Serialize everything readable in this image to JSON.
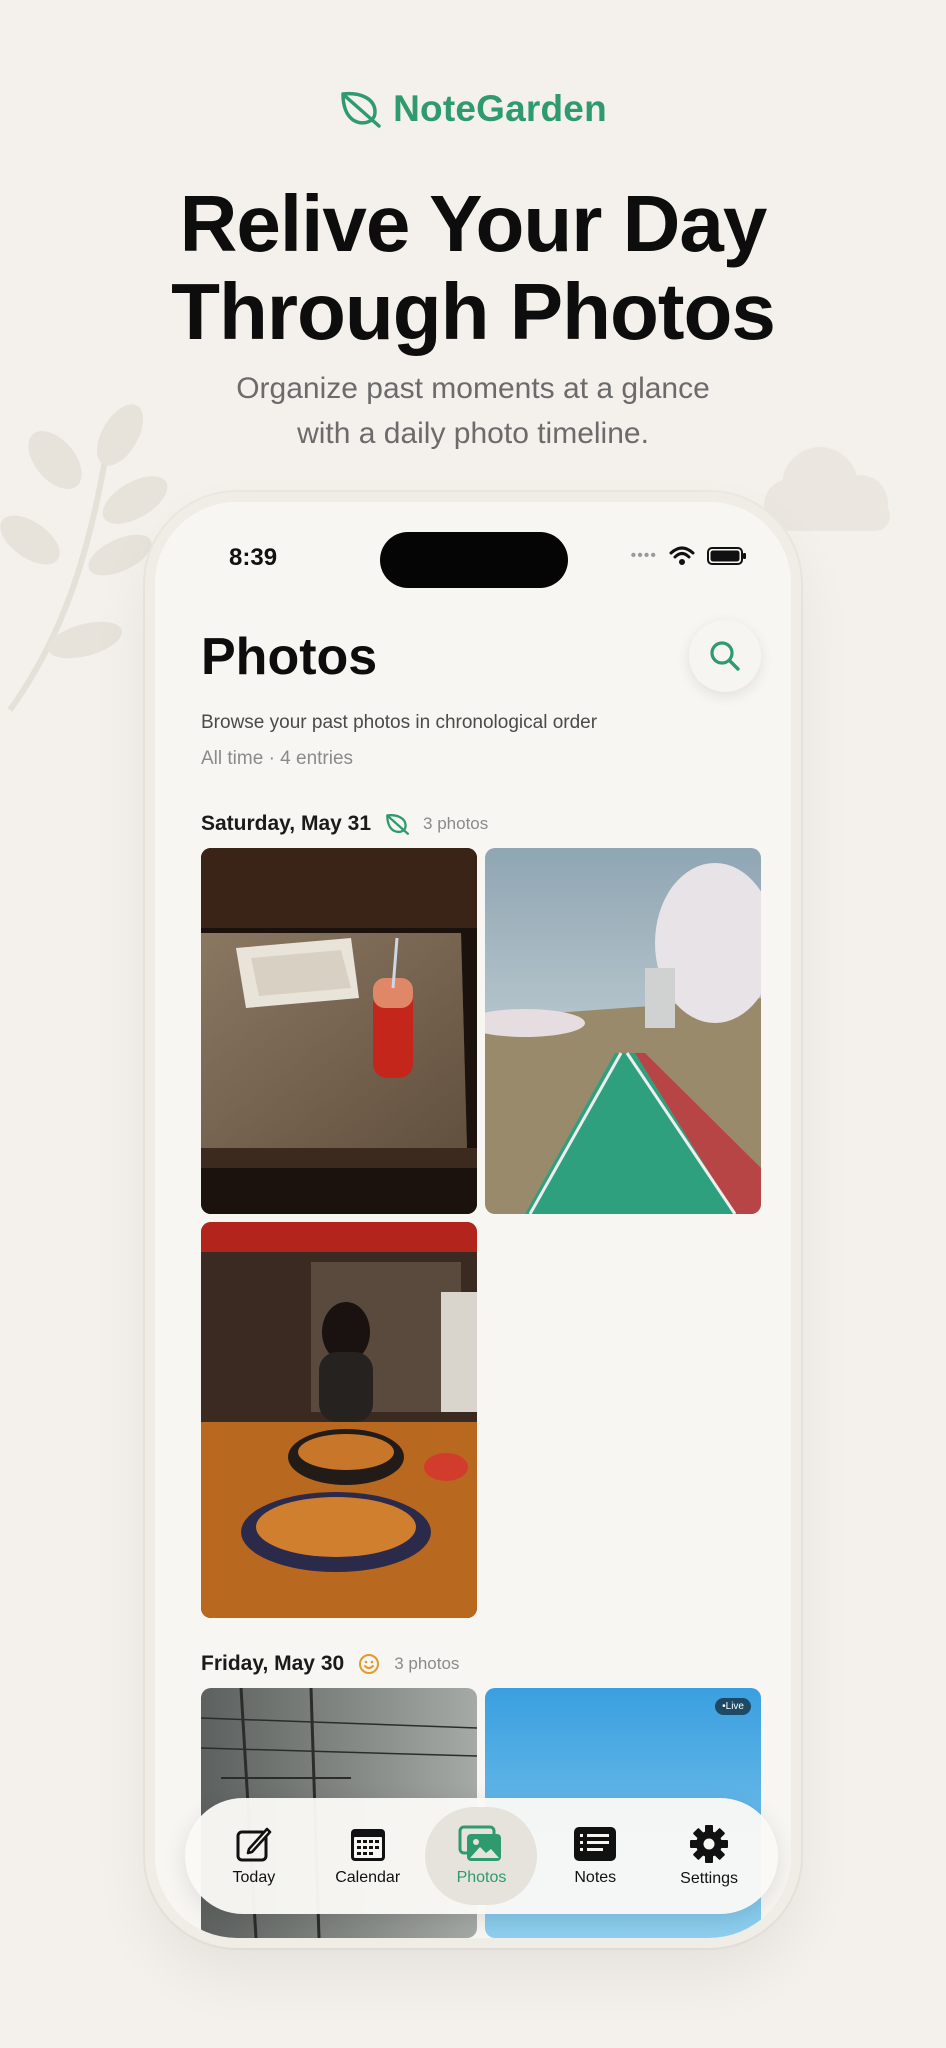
{
  "brand": {
    "name": "NoteGarden",
    "color": "#2e9a6e"
  },
  "headline": {
    "line1": "Relive Your Day",
    "line2": "Through Photos"
  },
  "subhead": {
    "line1": "Organize past moments at a glance",
    "line2": "with a daily photo timeline."
  },
  "status_bar": {
    "time": "8:39"
  },
  "screen": {
    "title": "Photos",
    "description": "Browse your past photos in chronological order",
    "meta": "All time · 4 entries"
  },
  "sections": [
    {
      "date": "Saturday, May 31",
      "icon": "leaf-icon",
      "count": "3 photos"
    },
    {
      "date": "Friday, May 30",
      "icon": "smiley-icon",
      "count": "3 photos"
    }
  ],
  "photos": [
    {
      "subject": "iced-tea-on-table"
    },
    {
      "subject": "cherry-blossom-path"
    },
    {
      "subject": "restaurant-food"
    },
    {
      "subject": "power-lines-fog"
    },
    {
      "subject": "blue-sky",
      "badge": "•Live"
    }
  ],
  "tabs": [
    {
      "label": "Today",
      "icon": "compose-icon",
      "active": false
    },
    {
      "label": "Calendar",
      "icon": "calendar-icon",
      "active": false
    },
    {
      "label": "Photos",
      "icon": "photos-icon",
      "active": true
    },
    {
      "label": "Notes",
      "icon": "notes-icon",
      "active": false
    },
    {
      "label": "Settings",
      "icon": "gear-icon",
      "active": false
    }
  ]
}
